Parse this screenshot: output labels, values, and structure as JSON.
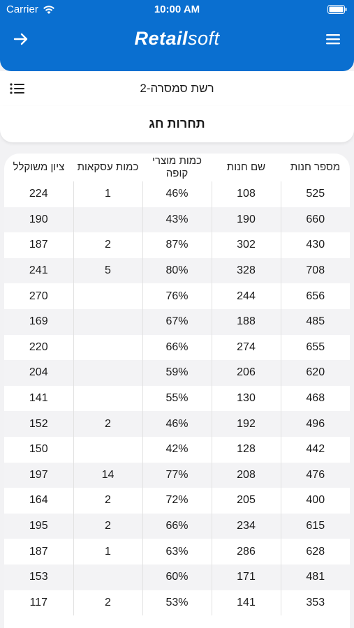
{
  "status_bar": {
    "carrier": "Carrier",
    "time": "10:00 AM"
  },
  "header": {
    "logo_bold": "Retail",
    "logo_light": "soft",
    "brand_color": "#0a6fd0",
    "back_icon": "arrow-right-icon",
    "menu_icon": "hamburger-icon"
  },
  "subheader": {
    "network_label": "רשת  סמסרה-2",
    "list_icon": "list-icon"
  },
  "page": {
    "title": "תחרות חג"
  },
  "table": {
    "columns": [
      "מספר חנות",
      "שם חנות",
      "כמות מוצרי קופה",
      "כמות עסקאות",
      "ציון משוקלל"
    ],
    "rows": [
      [
        "525",
        "108",
        "46%",
        "1",
        "224"
      ],
      [
        "660",
        "190",
        "43%",
        "",
        "190"
      ],
      [
        "430",
        "302",
        "87%",
        "2",
        "187"
      ],
      [
        "708",
        "328",
        "80%",
        "5",
        "241"
      ],
      [
        "656",
        "244",
        "76%",
        "",
        "270"
      ],
      [
        "485",
        "188",
        "67%",
        "",
        "169"
      ],
      [
        "655",
        "274",
        "66%",
        "",
        "220"
      ],
      [
        "620",
        "206",
        "59%",
        "",
        "204"
      ],
      [
        "468",
        "130",
        "55%",
        "",
        "141"
      ],
      [
        "496",
        "192",
        "46%",
        "2",
        "152"
      ],
      [
        "442",
        "128",
        "42%",
        "",
        "150"
      ],
      [
        "476",
        "208",
        "77%",
        "14",
        "197"
      ],
      [
        "400",
        "205",
        "72%",
        "2",
        "164"
      ],
      [
        "615",
        "234",
        "66%",
        "2",
        "195"
      ],
      [
        "628",
        "286",
        "63%",
        "1",
        "187"
      ],
      [
        "481",
        "171",
        "60%",
        "",
        "153"
      ],
      [
        "353",
        "141",
        "53%",
        "2",
        "117"
      ]
    ]
  }
}
